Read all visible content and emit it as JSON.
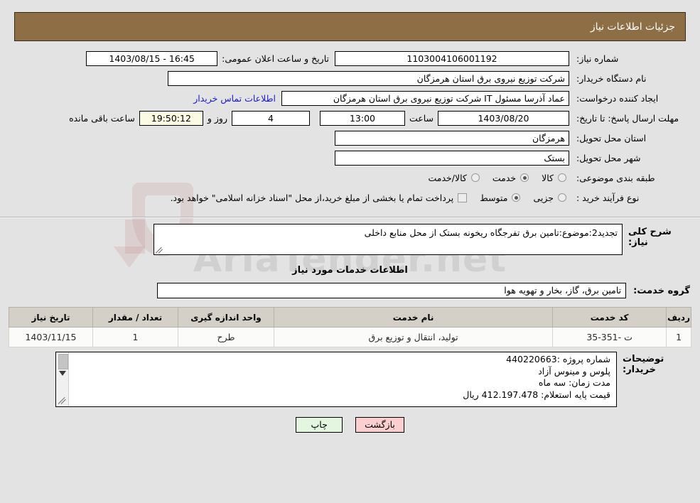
{
  "header": {
    "title": "جزئیات اطلاعات نیاز"
  },
  "watermark": {
    "text": "AriaTender.net"
  },
  "info": {
    "need_number_label": "شماره نیاز:",
    "need_number_value": "1103004106001192",
    "public_announce_label": "تاریخ و ساعت اعلان عمومی:",
    "public_announce_value": "1403/08/15 - 16:45",
    "buyer_org_label": "نام دستگاه خریدار:",
    "buyer_org_value": "شرکت توزیع نیروی برق استان هرمزگان",
    "creator_label": "ایجاد کننده درخواست:",
    "creator_value": "عماد آذرسا مسئول IT شرکت توزیع نیروی برق استان هرمزگان",
    "contact_link": "اطلاعات تماس خریدار",
    "deadline_label": "مهلت ارسال پاسخ: تا تاریخ:",
    "deadline_date": "1403/08/20",
    "hour_label": "ساعت",
    "deadline_time": "13:00",
    "days_left": "4",
    "days_label": "روز و",
    "timer": "19:50:12",
    "timer_suffix": "ساعت باقی مانده",
    "province_label": "استان محل تحویل:",
    "province_value": "هرمزگان",
    "city_label": "شهر محل تحویل:",
    "city_value": "بستک",
    "category_label": "طبقه بندی موضوعی:",
    "category_options": [
      {
        "label": "کالا",
        "selected": false
      },
      {
        "label": "خدمت",
        "selected": true
      },
      {
        "label": "کالا/خدمت",
        "selected": false
      }
    ],
    "process_label": "نوع فرآیند خرید :",
    "process_options": [
      {
        "label": "جزیی",
        "selected": false
      },
      {
        "label": "متوسط",
        "selected": true
      }
    ],
    "treasury_checkbox_checked": false,
    "treasury_note": "پرداخت تمام یا بخشی از مبلغ خرید،از محل \"اسناد خزانه اسلامی\" خواهد بود."
  },
  "need_description": {
    "label": "شرح کلی نیاز:",
    "value": "تجدید2:موضوع:تامین برق تفرجگاه ریخونه بستک  از محل منابع داخلی"
  },
  "services_section": {
    "title": "اطلاعات خدمات مورد نیاز",
    "group_label": "گروه خدمت:",
    "group_value": "تامین برق، گاز، بخار و تهویه هوا"
  },
  "items_table": {
    "headers": [
      "ردیف",
      "کد خدمت",
      "نام خدمت",
      "واحد اندازه گیری",
      "تعداد / مقدار",
      "تاریخ نیاز"
    ],
    "rows": [
      {
        "index": "1",
        "service_code": "ت -351-35",
        "service_name": "تولید، انتقال و توزیع برق",
        "unit": "طرح",
        "quantity": "1",
        "need_date": "1403/11/15"
      }
    ]
  },
  "buyer_notes": {
    "label": "توضیحات خریدار:",
    "value": "شماره پروژه :440220663\nپلوس و مینوس آزاد\nمدت زمان:  سه ماه\nقیمت پایه استعلام:   412.197.478  ریال"
  },
  "footer": {
    "print_label": "چاپ",
    "back_label": "بازگشت"
  },
  "colors": {
    "header_bg": "#8d6e45",
    "link": "#1a18d8",
    "timer_bg": "#fbfbe4",
    "back_btn_bg": "#fbcfcf",
    "print_btn_bg": "#e4f5e0",
    "table_header_bg": "#d4d0c8",
    "page_bg": "#e3e3e3"
  }
}
